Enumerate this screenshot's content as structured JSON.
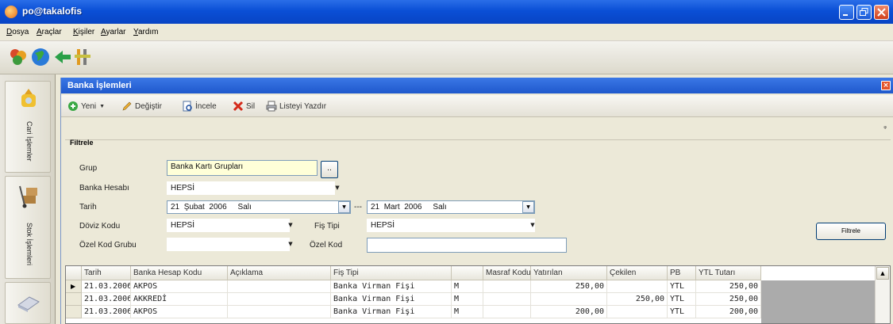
{
  "window": {
    "title": "po@takalofis"
  },
  "menu": [
    "Dosya",
    "Araçlar",
    "Kişiler",
    "Ayarlar",
    "Yardım"
  ],
  "toolbar_icons": [
    "users-icon",
    "globe-icon",
    "back-arrow-icon",
    "tools-icon"
  ],
  "leftnav": [
    {
      "label": "Cari İşlemler",
      "icon": "money-bag-icon"
    },
    {
      "label": "Stok İşlemleri",
      "icon": "hand-truck-icon"
    },
    {
      "label": "",
      "icon": "book-icon"
    }
  ],
  "form": {
    "title": "Banka İşlemleri",
    "toolbar": {
      "new": "Yeni",
      "edit": "Değiştir",
      "view": "İncele",
      "delete": "Sil",
      "print": "Listeyi Yazdır"
    },
    "filter": {
      "group_title": "Filtrele",
      "grup_label": "Grup",
      "grup_value": "Banka Kartı Grupları",
      "grup_button": "..",
      "hesap_label": "Banka Hesabı",
      "hesap_value": "HEPSİ",
      "tarih_label": "Tarih",
      "date_from": {
        "day": "21",
        "month": "Şubat",
        "year": "2006",
        "weekday": "Salı"
      },
      "date_sep": "---",
      "date_to": {
        "day": "21",
        "month": "Mart",
        "year": "2006",
        "weekday": "Salı"
      },
      "doviz_label": "Döviz Kodu",
      "doviz_value": "HEPSİ",
      "fis_label": "Fiş Tipi",
      "fis_value": "HEPSİ",
      "ozel_grup_label": "Özel Kod Grubu",
      "ozel_grup_value": "",
      "ozel_kod_label": "Özel Kod",
      "ozel_kod_value": "",
      "filter_button": "Filtrele"
    },
    "grid": {
      "columns": [
        "Tarih",
        "Banka Hesap Kodu",
        "Açıklama",
        "Fiş Tipi",
        "",
        "Masraf Kodu",
        "Yatırılan",
        "Çekilen",
        "PB",
        "YTL Tutarı"
      ],
      "rows": [
        [
          "21.03.2006",
          "AKPOS",
          "",
          "Banka Virman Fişi",
          "M",
          "",
          "250,00",
          "",
          "YTL",
          "250,00"
        ],
        [
          "21.03.2006",
          "AKKREDİ",
          "",
          "Banka Virman Fişi",
          "M",
          "",
          "",
          "250,00",
          "YTL",
          "250,00"
        ],
        [
          "21.03.2006",
          "AKPOS",
          "",
          "Banka Virman Fişi",
          "M",
          "",
          "200,00",
          "",
          "YTL",
          "200,00"
        ]
      ]
    }
  },
  "colors": {
    "titlebar": "#0a4fd6",
    "form_title": "#2a64d8",
    "close": "#e4542a"
  }
}
